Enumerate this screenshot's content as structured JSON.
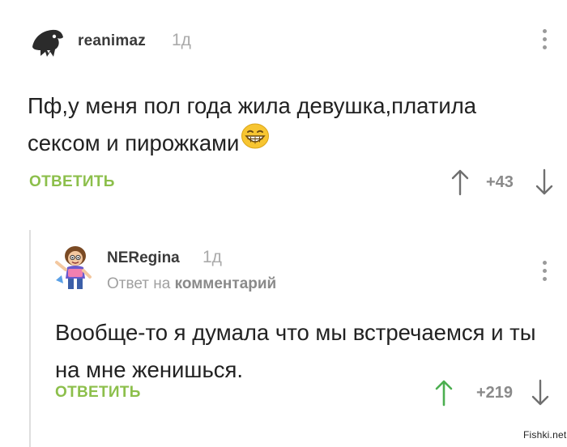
{
  "comment1": {
    "username": "reanimaz",
    "time": "1д",
    "text": "Пф,у меня пол года жила девушка,платила сексом и пирожками",
    "reply_label": "ОТВЕТИТЬ",
    "votes": "+43"
  },
  "comment2": {
    "username": "NERegina",
    "time": "1д",
    "reply_prefix": "Ответ на",
    "reply_target": "комментарий",
    "text": "Вообще-то я думала что мы встречаемся и ты на мне женишься.",
    "reply_label": "ОТВЕТИТЬ",
    "votes": "+219"
  },
  "watermark": "Fishki.net",
  "colors": {
    "accent": "#8cbf4b",
    "upvote_active": "#4caf50",
    "muted": "#9a9a9a"
  },
  "icons": {
    "emoji": "grinning-face-emoji",
    "upvote": "arrow-up-icon",
    "downvote": "arrow-down-icon",
    "more": "more-vertical-icon"
  }
}
